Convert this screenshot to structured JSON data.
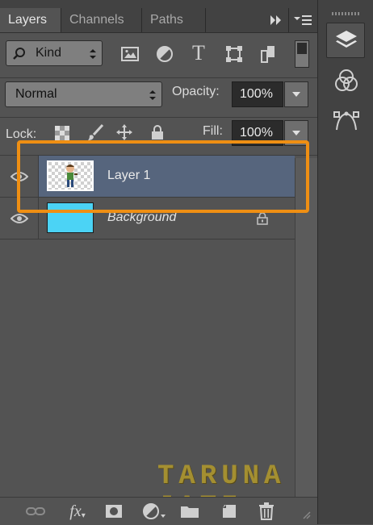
{
  "tabs": [
    {
      "label": "Layers",
      "active": true
    },
    {
      "label": "Channels",
      "active": false
    },
    {
      "label": "Paths",
      "active": false
    }
  ],
  "filter": {
    "kind_label": "Kind",
    "icons": [
      "pixel-layer-filter-icon",
      "adjustment-layer-filter-icon",
      "type-layer-filter-icon",
      "shape-layer-filter-icon",
      "smart-object-filter-icon"
    ]
  },
  "blend": {
    "mode": "Normal",
    "opacity_label": "Opacity:",
    "opacity_value": "100%"
  },
  "lock": {
    "label": "Lock:",
    "fill_label": "Fill:",
    "fill_value": "100%"
  },
  "layers": [
    {
      "name": "Layer 1",
      "selected": true,
      "visible": true,
      "locked": false
    },
    {
      "name": "Background",
      "selected": false,
      "visible": true,
      "locked": true
    }
  ],
  "bottom_icons": [
    "link-layers-icon",
    "fx-icon",
    "add-mask-icon",
    "adjustment-icon",
    "new-group-icon",
    "new-layer-icon",
    "delete-layer-icon"
  ],
  "fx_label": "fx",
  "watermark": "TARUNA JATI",
  "colors": {
    "accent_highlight": "#ef8f13",
    "selected_row": "#56657d",
    "background_layer_fill": "#4bd3f5",
    "panel_bg": "#535353"
  }
}
